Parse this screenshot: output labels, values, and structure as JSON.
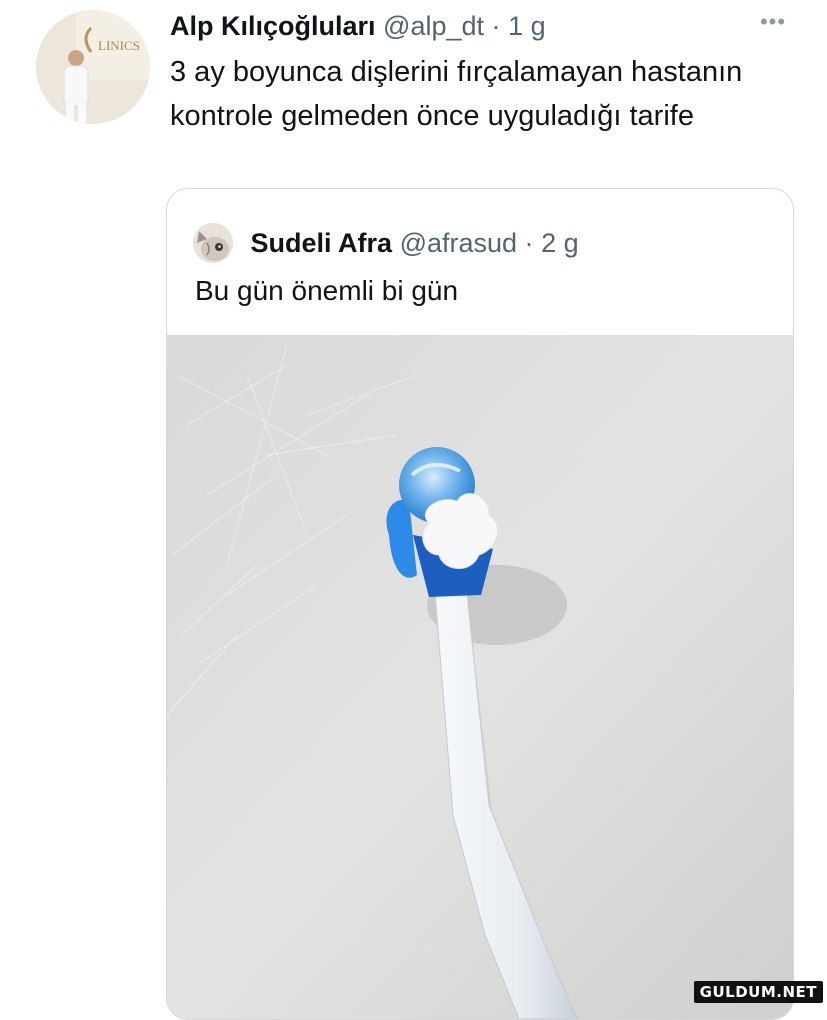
{
  "tweet": {
    "author_name": "Alp Kılıçoğluları",
    "author_handle": "@alp_dt",
    "separator": "·",
    "time": "1 g",
    "text": "3 ay boyunca dişlerini fırçalamayan hastanın kontrole gelmeden önce uyguladığı tarife",
    "avatar_sign_text": "LINICS",
    "more_icon": "ellipsis-horizontal-icon"
  },
  "quoted_tweet": {
    "author_name": "Sudeli Afra",
    "author_handle": "@afrasud",
    "separator": "·",
    "time": "2 g",
    "text": "Bu gün önemli bi gün",
    "media_description_icon": "toothbrush-photo"
  },
  "watermark": "GULDUM.NET",
  "colors": {
    "text_primary": "#0f1419",
    "text_secondary": "#536471",
    "border": "#cfd9de",
    "toothpaste_blue": "#2f8fe0"
  }
}
